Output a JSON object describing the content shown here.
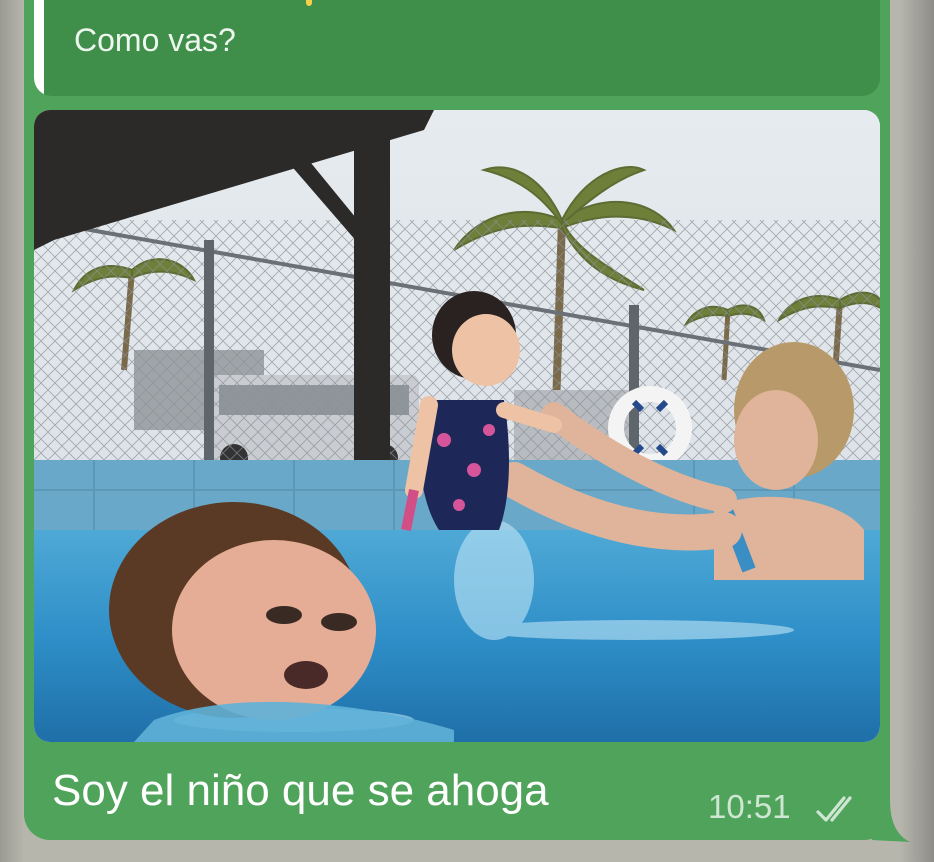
{
  "message": {
    "reply_preview": {
      "text": "Como vas?"
    },
    "image": {
      "icon": "photo-icon"
    },
    "caption": "Soy el niño que se ahoga",
    "time": "10:51",
    "status_icon": "double-check-icon"
  },
  "colors": {
    "bubble": "#4fa35b",
    "reply_block": "#3f8e4a",
    "reply_bar": "#ffffff",
    "text": "#ffffff",
    "time": "#cfe6d2"
  }
}
